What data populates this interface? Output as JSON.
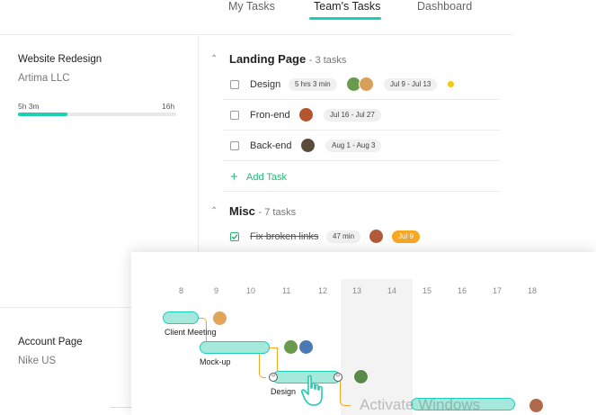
{
  "nav": {
    "tabs": [
      {
        "label": "My Tasks"
      },
      {
        "label": "Team's Tasks"
      },
      {
        "label": "Dashboard"
      }
    ]
  },
  "projects": [
    {
      "title": "Website Redesign",
      "client": "Artima LLC",
      "progress_label": "5h 3m",
      "total_label": "16h",
      "progress": 0.31
    },
    {
      "title": "Account Page",
      "client": "Nike US"
    }
  ],
  "sections": [
    {
      "title": "Landing Page",
      "count": "- 3 tasks",
      "tasks": [
        {
          "name": "Design",
          "time": "5 hrs 3 min",
          "dates": "Jul 9 - Jul 13"
        },
        {
          "name": "Fron-end",
          "dates": "Jul 16 - Jul 27"
        },
        {
          "name": "Back-end",
          "dates": "Aug 1 - Aug 3"
        }
      ],
      "add_label": "Add Task"
    },
    {
      "title": "Misc",
      "count": "- 7 tasks",
      "tasks": [
        {
          "name": "Fix broken links",
          "time": "47 min",
          "date": "Jul 9",
          "done": true
        }
      ]
    }
  ],
  "gantt": {
    "days": [
      "8",
      "9",
      "10",
      "11",
      "12",
      "13",
      "14",
      "15",
      "16",
      "17",
      "18"
    ],
    "bars": [
      {
        "label": "Client Meeting"
      },
      {
        "label": "Mock-up"
      },
      {
        "label": "Design"
      }
    ]
  },
  "watermark": "Activate Windows",
  "colors": {
    "accent": "#1ccfb5",
    "green": "#2bb673",
    "orange": "#f7a823",
    "connector": "#f5a623"
  }
}
